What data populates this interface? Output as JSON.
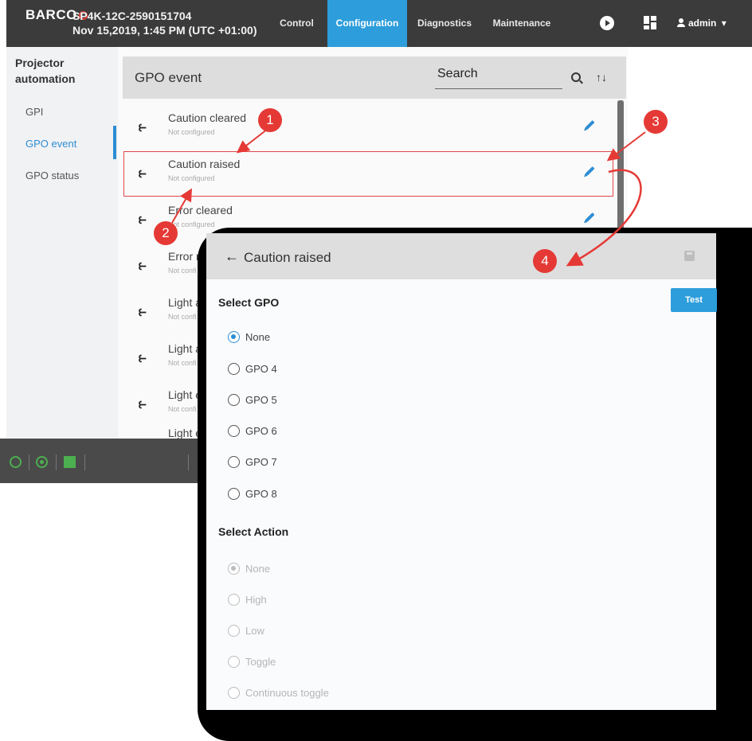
{
  "topbar": {
    "logo": "BARCO",
    "device_name": "SP4K-12C-2590151704",
    "datetime": "Nov 15,2019, 1:45 PM (UTC +01:00)",
    "tabs": [
      {
        "label": "Control",
        "active": false
      },
      {
        "label": "Configuration",
        "active": true
      },
      {
        "label": "Diagnostics",
        "active": false
      },
      {
        "label": "Maintenance",
        "active": false
      }
    ],
    "user": "admin",
    "icons": [
      "play-icon",
      "dashboard-icon",
      "user-icon",
      "caret-down-icon"
    ],
    "accent": "#2d9ddb"
  },
  "leftmenu": {
    "title": "Projector automation",
    "items": [
      {
        "label": "GPI",
        "active": false
      },
      {
        "label": "GPO event",
        "active": true
      },
      {
        "label": "GPO status",
        "active": false
      }
    ]
  },
  "list": {
    "title": "GPO event",
    "search_placeholder": "Search",
    "sort_glyph": "↑↓",
    "rows": [
      {
        "name": "Caution cleared",
        "status": "Not configured"
      },
      {
        "name": "Caution raised",
        "status": "Not configured"
      },
      {
        "name": "Error cleared",
        "status": "Not configured"
      },
      {
        "name": "Error ra",
        "status": "Not confi"
      },
      {
        "name": "Light af",
        "status": "Not confi"
      },
      {
        "name": "Light af",
        "status": "Not confi"
      },
      {
        "name": "Light en",
        "status": "Not confi"
      },
      {
        "name": "Light en",
        "status": ""
      }
    ]
  },
  "detail": {
    "back_glyph": "←",
    "title": "Caution raised",
    "test_label": "Test",
    "select_gpo_title": "Select GPO",
    "gpo_options": [
      {
        "label": "None",
        "checked": true
      },
      {
        "label": "GPO 4",
        "checked": false
      },
      {
        "label": "GPO 5",
        "checked": false
      },
      {
        "label": "GPO 6",
        "checked": false
      },
      {
        "label": "GPO 7",
        "checked": false
      },
      {
        "label": "GPO 8",
        "checked": false
      }
    ],
    "select_action_title": "Select Action",
    "action_options": [
      {
        "label": "None",
        "checked": true,
        "disabled": true
      },
      {
        "label": "High",
        "checked": false,
        "disabled": true
      },
      {
        "label": "Low",
        "checked": false,
        "disabled": true
      },
      {
        "label": "Toggle",
        "checked": false,
        "disabled": true
      },
      {
        "label": "Continuous toggle",
        "checked": false,
        "disabled": true
      }
    ]
  },
  "footer": {
    "icons": [
      "lightbulb-icon",
      "target-icon",
      "grid-icon"
    ],
    "icon_color": "#4caf50"
  },
  "callouts": [
    "1",
    "2",
    "3",
    "4"
  ],
  "colors": {
    "callout": "#e53935",
    "highlight": "#e04848",
    "link_blue": "#2d8dd3"
  }
}
